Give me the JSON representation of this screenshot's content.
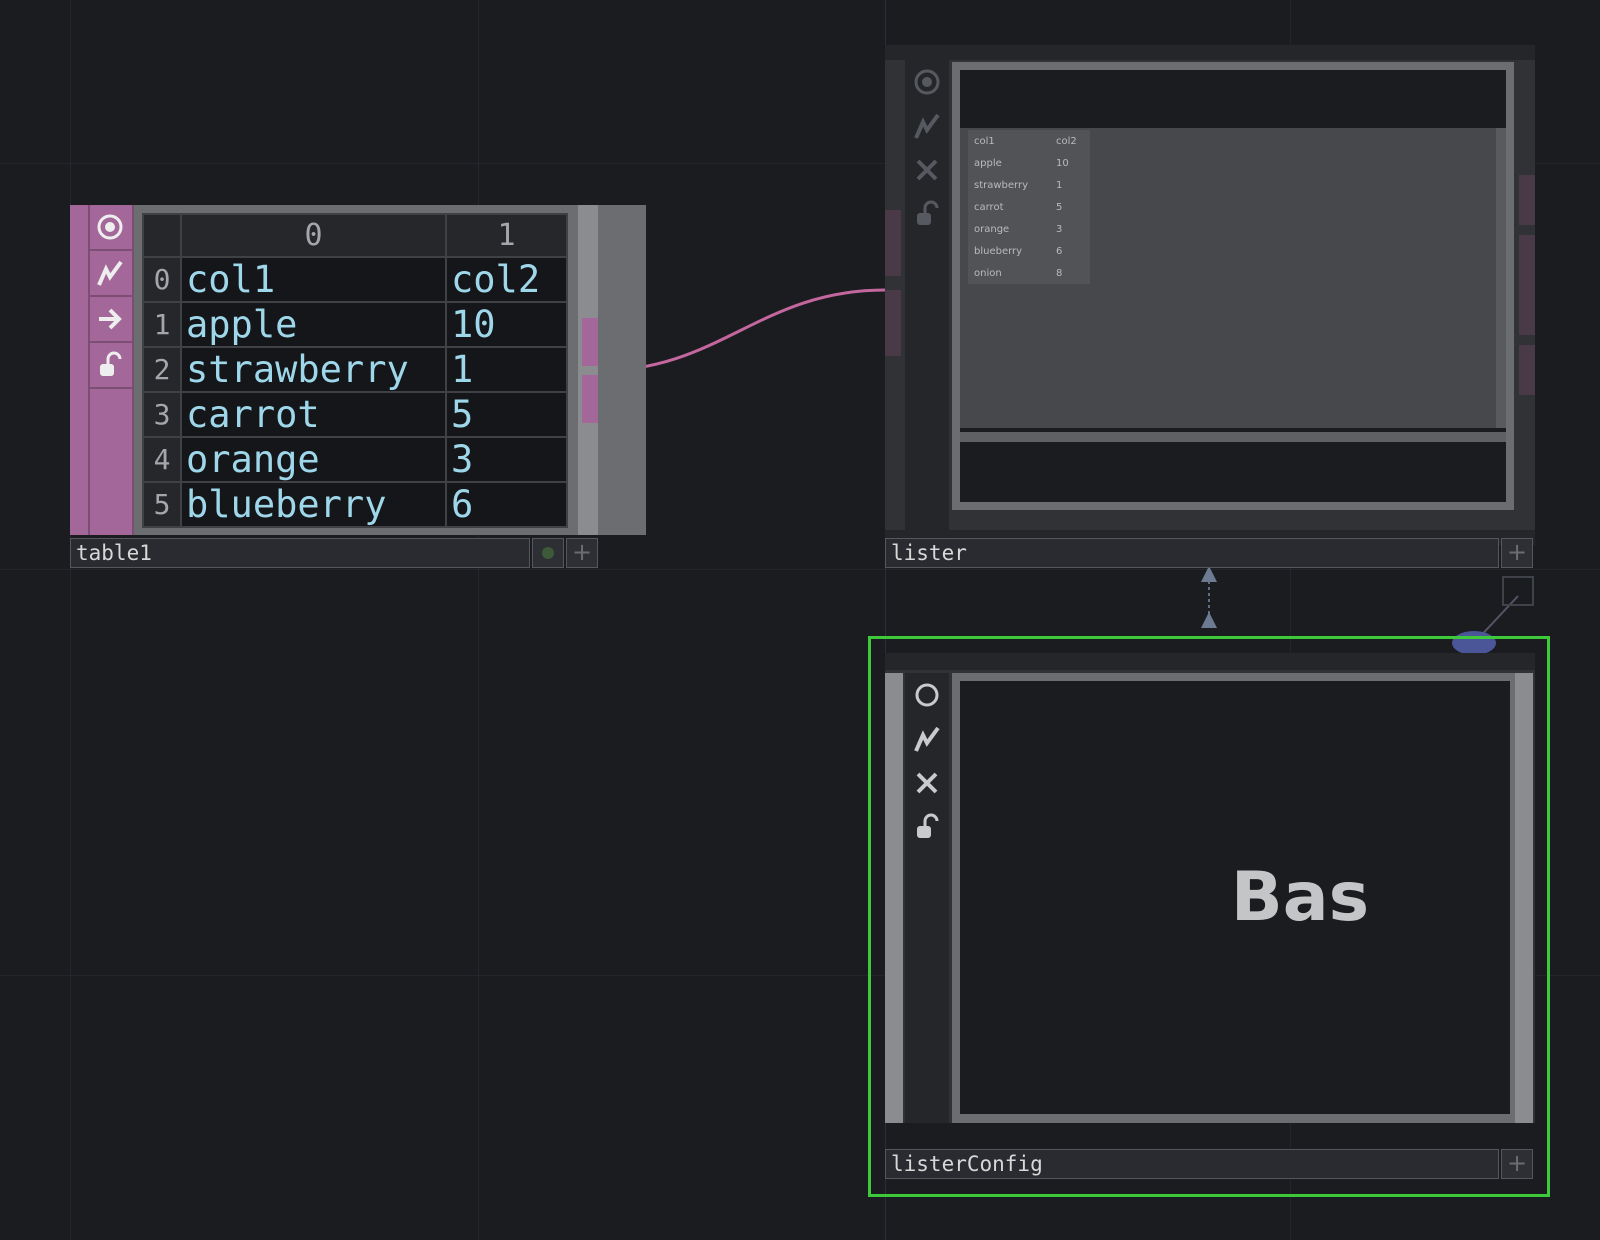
{
  "colors": {
    "background": "#1b1c20",
    "dat_operator": "#a4679a",
    "selected_border": "#3ec93a",
    "cell_text": "#9fd7ea",
    "wire": "#c4679e"
  },
  "table1": {
    "name": "table1",
    "header": [
      "0",
      "1"
    ],
    "rows": [
      {
        "index": "0",
        "col0": "col1",
        "col1": "col2"
      },
      {
        "index": "1",
        "col0": "apple",
        "col1": "10"
      },
      {
        "index": "2",
        "col0": "strawberry",
        "col1": "1"
      },
      {
        "index": "3",
        "col0": "carrot",
        "col1": "5"
      },
      {
        "index": "4",
        "col0": "orange",
        "col1": "3"
      },
      {
        "index": "5",
        "col0": "blueberry",
        "col1": "6"
      }
    ],
    "flags": [
      "viewer-active-icon",
      "bypass-icon",
      "output-arrow-icon",
      "lock-icon"
    ]
  },
  "lister": {
    "name": "lister",
    "preview_rows": [
      {
        "a": "col1",
        "b": "col2"
      },
      {
        "a": "apple",
        "b": "10"
      },
      {
        "a": "strawberry",
        "b": "1"
      },
      {
        "a": "carrot",
        "b": "5"
      },
      {
        "a": "orange",
        "b": "3"
      },
      {
        "a": "blueberry",
        "b": "6"
      },
      {
        "a": "onion",
        "b": "8"
      }
    ],
    "flags": [
      "viewer-active-icon",
      "bypass-icon",
      "close-icon",
      "lock-icon"
    ]
  },
  "listerConfig": {
    "name": "listerConfig",
    "preview_text": "Bas",
    "flags": [
      "circle-icon",
      "bypass-icon",
      "close-icon",
      "lock-icon"
    ]
  },
  "icons": {
    "plus": "+"
  }
}
